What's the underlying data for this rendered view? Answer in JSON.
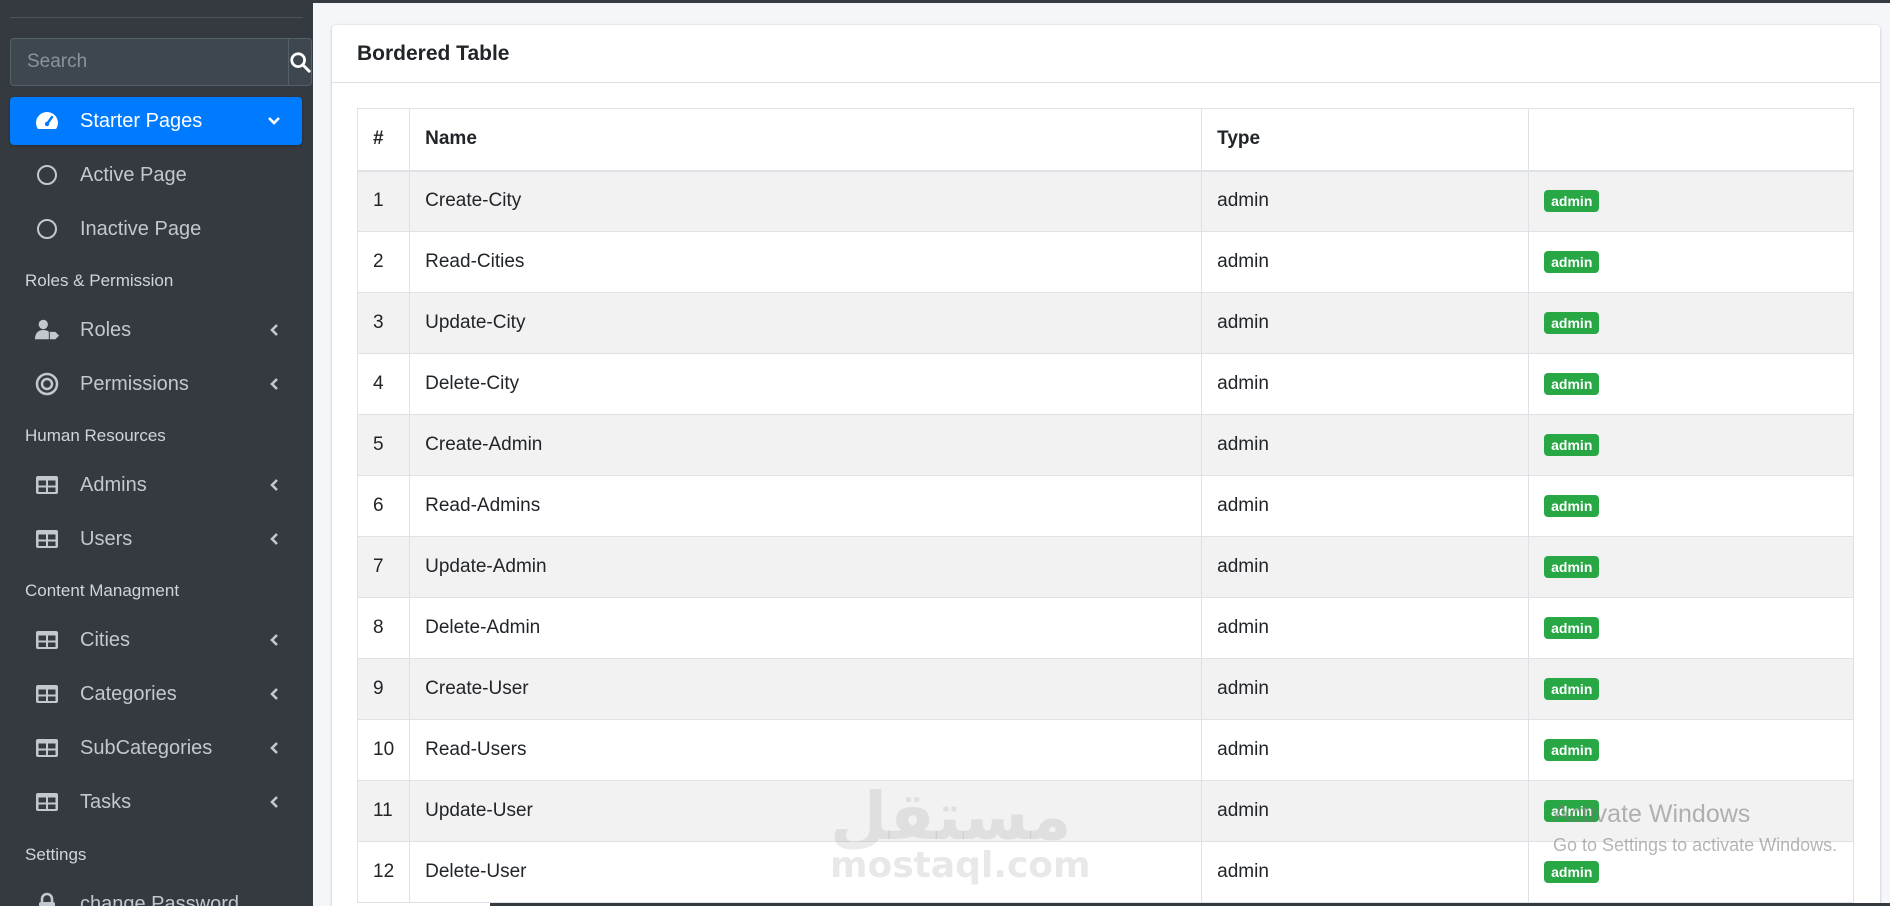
{
  "sidebar": {
    "search_placeholder": "Search",
    "starter": {
      "label": "Starter Pages",
      "children": [
        "Active Page",
        "Inactive Page"
      ]
    },
    "sections": {
      "roles": "Roles & Permission",
      "hr": "Human Resources",
      "content": "Content Managment",
      "settings": "Settings"
    },
    "items": {
      "roles": "Roles",
      "permissions": "Permissions",
      "admins": "Admins",
      "users": "Users",
      "cities": "Cities",
      "categories": "Categories",
      "subcategories": "SubCategories",
      "tasks": "Tasks",
      "change_password": "change Password"
    },
    "accent_color": "#007bff"
  },
  "card": {
    "title": "Bordered Table",
    "columns": [
      "#",
      "Name",
      "Type",
      ""
    ],
    "rows": [
      {
        "id": "1",
        "name": "Create-City",
        "type": "admin",
        "badge": "admin"
      },
      {
        "id": "2",
        "name": "Read-Cities",
        "type": "admin",
        "badge": "admin"
      },
      {
        "id": "3",
        "name": "Update-City",
        "type": "admin",
        "badge": "admin"
      },
      {
        "id": "4",
        "name": "Delete-City",
        "type": "admin",
        "badge": "admin"
      },
      {
        "id": "5",
        "name": "Create-Admin",
        "type": "admin",
        "badge": "admin"
      },
      {
        "id": "6",
        "name": "Read-Admins",
        "type": "admin",
        "badge": "admin"
      },
      {
        "id": "7",
        "name": "Update-Admin",
        "type": "admin",
        "badge": "admin"
      },
      {
        "id": "8",
        "name": "Delete-Admin",
        "type": "admin",
        "badge": "admin"
      },
      {
        "id": "9",
        "name": "Create-User",
        "type": "admin",
        "badge": "admin"
      },
      {
        "id": "10",
        "name": "Read-Users",
        "type": "admin",
        "badge": "admin"
      },
      {
        "id": "11",
        "name": "Update-User",
        "type": "admin",
        "badge": "admin"
      },
      {
        "id": "12",
        "name": "Delete-User",
        "type": "admin",
        "badge": "admin"
      }
    ],
    "badge_color": "#28a745"
  },
  "overlay": {
    "watermark_logo": "مستقل",
    "watermark_site": "mostaql.com",
    "activate_title": "Activate Windows",
    "activate_sub": "Go to Settings to activate Windows."
  }
}
